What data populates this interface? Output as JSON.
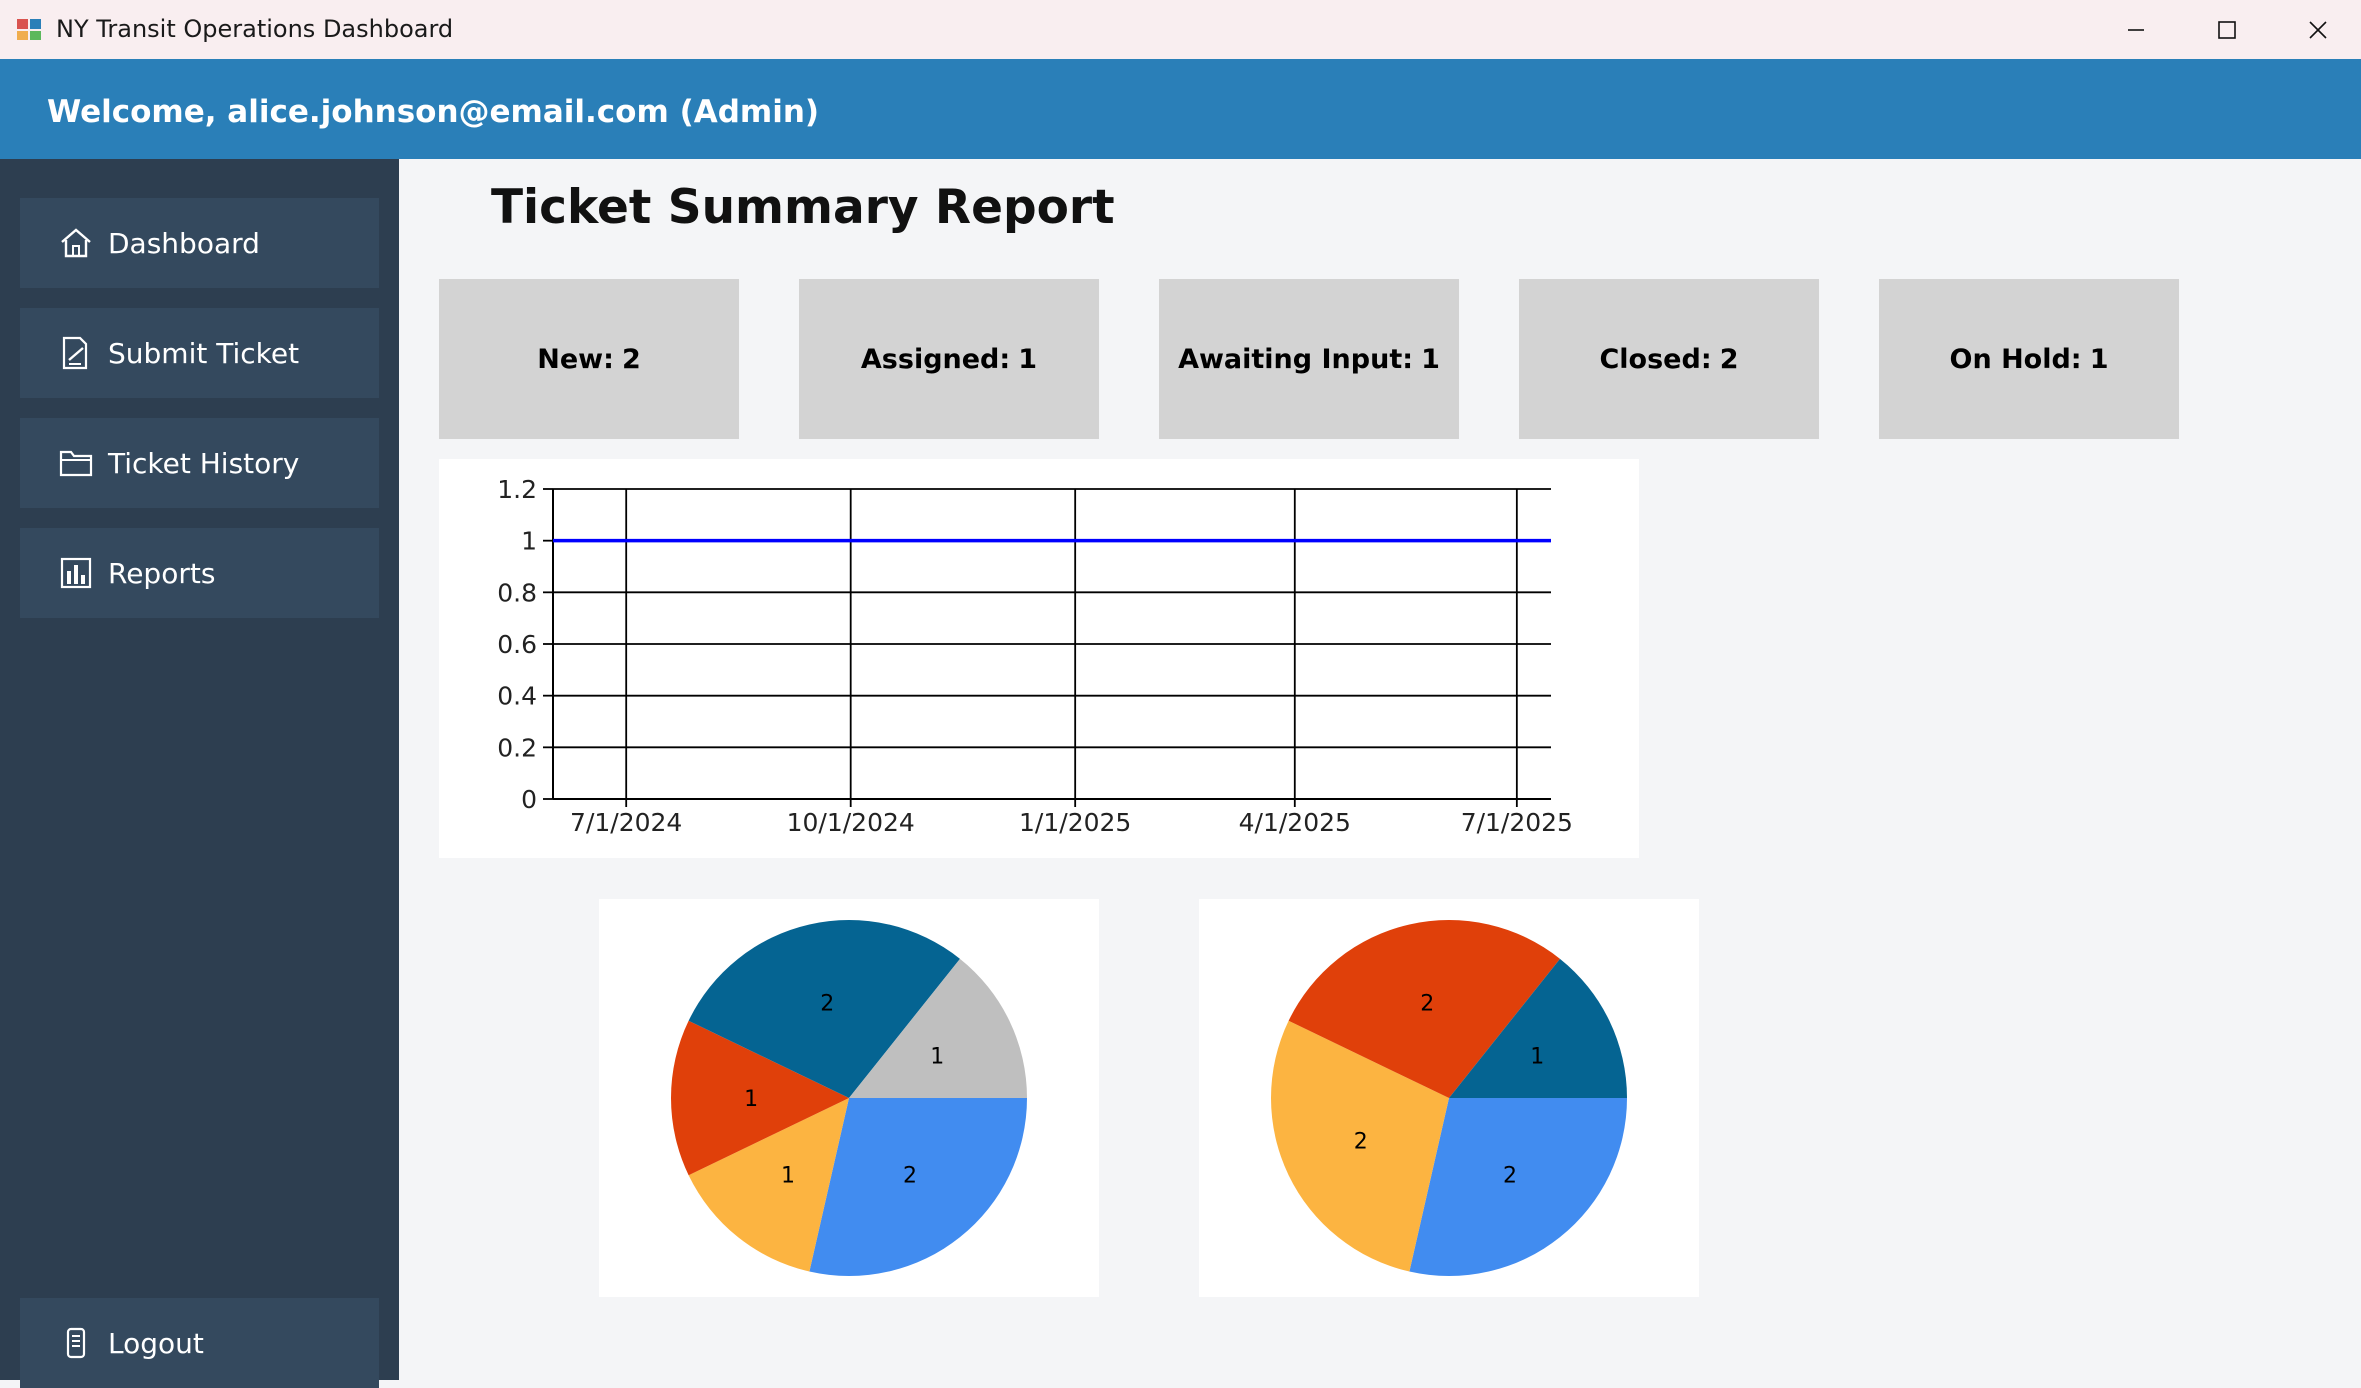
{
  "window": {
    "title": "NY Transit Operations Dashboard",
    "controls": [
      "minimize-icon",
      "maximize-icon",
      "close-icon"
    ]
  },
  "header": {
    "welcome": "Welcome, alice.johnson@email.com (Admin)",
    "color": "#2a7fb8"
  },
  "sidebar": {
    "items": [
      {
        "label": "Dashboard",
        "icon": "home-icon"
      },
      {
        "label": "Submit Ticket",
        "icon": "edit-document-icon"
      },
      {
        "label": "Ticket History",
        "icon": "folder-icon"
      },
      {
        "label": "Reports",
        "icon": "bar-chart-icon"
      }
    ],
    "logout": {
      "label": "Logout",
      "icon": "phone-icon"
    }
  },
  "main": {
    "title": "Ticket Summary Report",
    "cards": [
      {
        "label": "New:",
        "count": "2"
      },
      {
        "label": "Assigned:",
        "count": "1"
      },
      {
        "label": "Awaiting Input:",
        "count": "1"
      },
      {
        "label": "Closed:",
        "count": "2"
      },
      {
        "label": "On Hold:",
        "count": "1"
      }
    ]
  },
  "chart_data": [
    {
      "type": "line",
      "x": [
        "6/1/2024",
        "7/15/2025"
      ],
      "series": [
        {
          "values": [
            1,
            1
          ],
          "color": "#0000ff"
        }
      ],
      "x_ticks": [
        "7/1/2024",
        "10/1/2024",
        "1/1/2025",
        "4/1/2025",
        "7/1/2025"
      ],
      "y_ticks": [
        "0",
        "0.2",
        "0.4",
        "0.6",
        "0.8",
        "1",
        "1.2"
      ],
      "ylim": [
        0,
        1.2
      ],
      "grid": true
    },
    {
      "type": "pie",
      "slices": [
        {
          "value": 2,
          "label": "2",
          "color": "#418cf0"
        },
        {
          "value": 1,
          "label": "1",
          "color": "#fcb441"
        },
        {
          "value": 1,
          "label": "1",
          "color": "#e0400a"
        },
        {
          "value": 2,
          "label": "2",
          "color": "#056492"
        },
        {
          "value": 1,
          "label": "1",
          "color": "#bfbfbf"
        }
      ]
    },
    {
      "type": "pie",
      "slices": [
        {
          "value": 2,
          "label": "2",
          "color": "#418cf0"
        },
        {
          "value": 2,
          "label": "2",
          "color": "#fcb441"
        },
        {
          "value": 2,
          "label": "2",
          "color": "#e0400a"
        },
        {
          "value": 1,
          "label": "1",
          "color": "#056492"
        }
      ]
    }
  ]
}
